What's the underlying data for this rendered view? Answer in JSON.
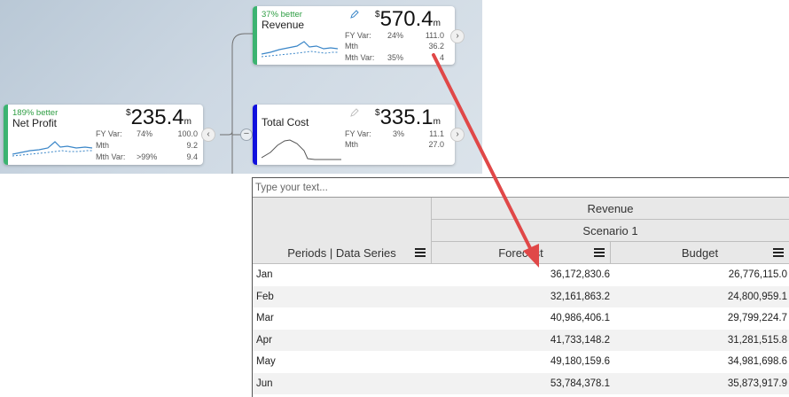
{
  "tree": {
    "net_profit": {
      "badge": "189% better",
      "title": "Net Profit",
      "currency": "$",
      "value": "235.4",
      "unit": "m",
      "rows": [
        {
          "label": "FY Var:",
          "pct": "74%",
          "val": "100.0"
        },
        {
          "label": "Mth",
          "pct": "",
          "val": "9.2"
        },
        {
          "label": "Mth Var:",
          "pct": ">99%",
          "val": "9.4"
        }
      ],
      "accent": "#3cb371"
    },
    "revenue": {
      "badge": "37% better",
      "title": "Revenue",
      "currency": "$",
      "value": "570.4",
      "unit": "m",
      "rows": [
        {
          "label": "FY Var:",
          "pct": "24%",
          "val": "111.0"
        },
        {
          "label": "Mth",
          "pct": "",
          "val": "36.2"
        },
        {
          "label": "Mth Var:",
          "pct": "35%",
          "val": "4"
        }
      ],
      "accent": "#3cb371"
    },
    "total_cost": {
      "title": "Total Cost",
      "currency": "$",
      "value": "335.1",
      "unit": "m",
      "rows": [
        {
          "label": "FY Var:",
          "pct": "3%",
          "val": "11.1"
        },
        {
          "label": "Mth",
          "pct": "",
          "val": "27.0"
        }
      ],
      "accent": "#1010dd"
    },
    "icons": {
      "expand": "chevron-right-icon",
      "collapse_left": "chevron-left-icon",
      "collapse_node": "minus-circle-icon",
      "edit": "pencil-icon"
    }
  },
  "grid": {
    "search_placeholder": "Type your text...",
    "header_group": "Revenue",
    "header_scenario": "Scenario 1",
    "col_periods": "Periods | Data Series",
    "col_forecast": "Forecast",
    "col_budget": "Budget",
    "rows": [
      {
        "period": "Jan",
        "forecast": "36,172,830.6",
        "budget": "26,776,115.0"
      },
      {
        "period": "Feb",
        "forecast": "32,161,863.2",
        "budget": "24,800,959.1"
      },
      {
        "period": "Mar",
        "forecast": "40,986,406.1",
        "budget": "29,799,224.7"
      },
      {
        "period": "Apr",
        "forecast": "41,733,148.2",
        "budget": "31,281,515.8"
      },
      {
        "period": "May",
        "forecast": "49,180,159.6",
        "budget": "34,981,698.6"
      },
      {
        "period": "Jun",
        "forecast": "53,784,378.1",
        "budget": "35,873,917.9"
      }
    ]
  },
  "colors": {
    "arrow": "#e04848",
    "positive": "#2f9e44",
    "spark": "#3a86c8"
  }
}
